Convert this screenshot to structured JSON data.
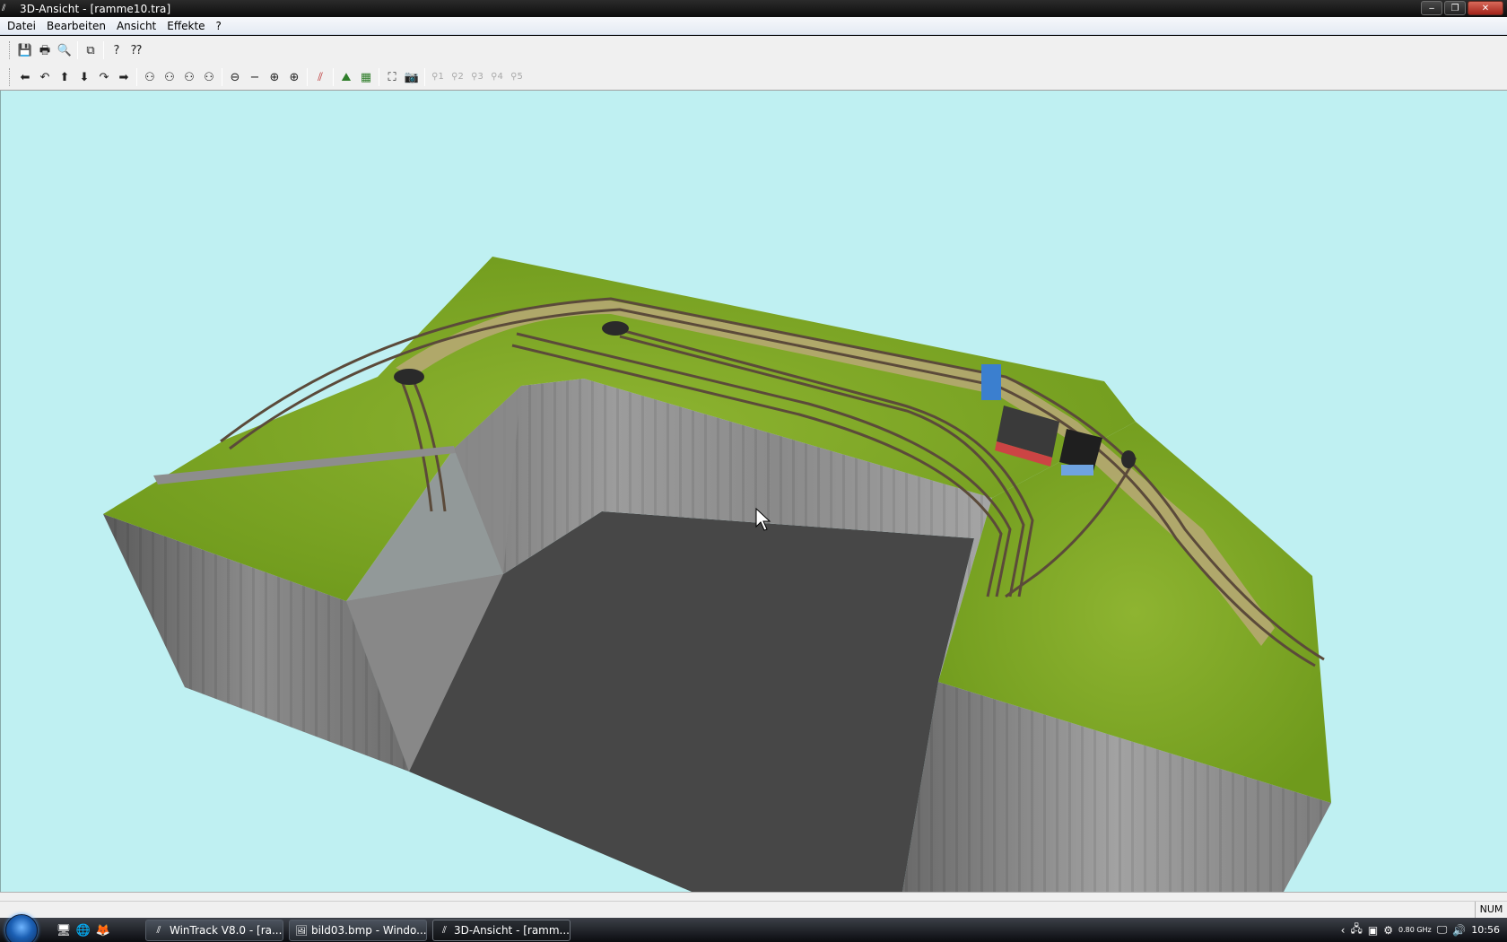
{
  "window": {
    "title": "3D-Ansicht - [ramme10.tra]",
    "controls": {
      "minimize": "‒",
      "maximize": "❐",
      "close": "✕"
    }
  },
  "menu": {
    "items": [
      "Datei",
      "Bearbeiten",
      "Ansicht",
      "Effekte",
      "?"
    ]
  },
  "toolbar1": {
    "buttons": [
      {
        "name": "save-icon",
        "glyph": "💾"
      },
      {
        "name": "print-icon",
        "glyph": "🖶"
      },
      {
        "name": "print-preview-icon",
        "glyph": "🔍"
      },
      {
        "name": "copy-icon",
        "glyph": "⧉"
      },
      {
        "name": "help-icon",
        "glyph": "?"
      },
      {
        "name": "context-help-icon",
        "glyph": "⁇"
      }
    ]
  },
  "toolbar2": {
    "buttons": [
      {
        "name": "move-left-icon",
        "glyph": "⬅"
      },
      {
        "name": "rotate-left-icon",
        "glyph": "↶"
      },
      {
        "name": "move-up-icon",
        "glyph": "⬆"
      },
      {
        "name": "move-down-icon",
        "glyph": "⬇"
      },
      {
        "name": "rotate-right-icon",
        "glyph": "↷"
      },
      {
        "name": "move-right-icon",
        "glyph": "➡"
      },
      {
        "name": "view-tilt-1-icon",
        "glyph": "⚇"
      },
      {
        "name": "view-tilt-2-icon",
        "glyph": "⚇"
      },
      {
        "name": "view-tilt-3-icon",
        "glyph": "⚇"
      },
      {
        "name": "view-tilt-4-icon",
        "glyph": "⚇"
      },
      {
        "name": "zoom-out-full-icon",
        "glyph": "⊖"
      },
      {
        "name": "zoom-out-icon",
        "glyph": "−"
      },
      {
        "name": "zoom-in-icon",
        "glyph": "⊕"
      },
      {
        "name": "zoom-in-full-icon",
        "glyph": "⊕"
      },
      {
        "name": "track-tool-icon",
        "glyph": "⫽"
      },
      {
        "name": "terrain-icon",
        "glyph": "⛰"
      },
      {
        "name": "grid-icon",
        "glyph": "▦"
      },
      {
        "name": "fit-view-icon",
        "glyph": "⛶"
      },
      {
        "name": "camera-icon",
        "glyph": "📷"
      }
    ],
    "viewpoints": [
      "1",
      "2",
      "3",
      "4",
      "5"
    ]
  },
  "status": {
    "num_indicator": "NUM"
  },
  "taskbar": {
    "tasks": [
      {
        "label": "WinTrack  V8.0 - [ra...",
        "active": false,
        "icon": "wintrack-icon"
      },
      {
        "label": "bild03.bmp - Windo...",
        "active": false,
        "icon": "image-viewer-icon"
      },
      {
        "label": "3D-Ansicht - [ramm...",
        "active": true,
        "icon": "wintrack-3d-icon"
      }
    ],
    "cpu_speed": "0.80 GHz",
    "clock": "10:56"
  }
}
